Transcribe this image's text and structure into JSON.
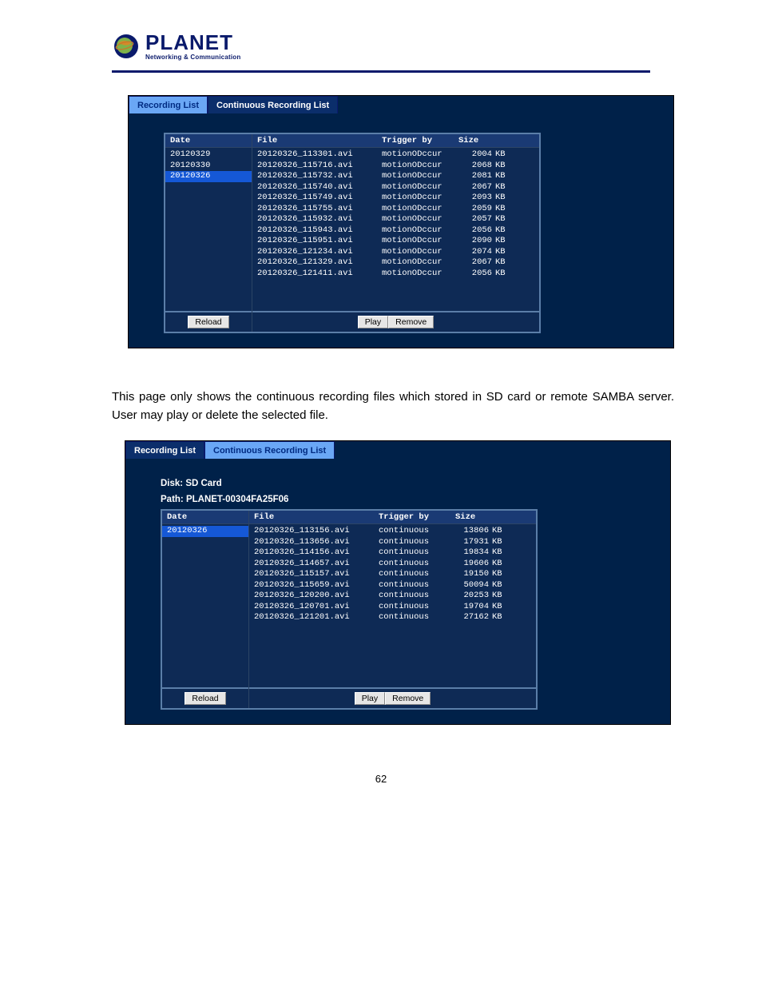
{
  "brand": {
    "name": "PLANET",
    "tagline": "Networking & Communication"
  },
  "tabs": {
    "recording": "Recording List",
    "continuous": "Continuous Recording List"
  },
  "columns": {
    "date": "Date",
    "file": "File",
    "trigger": "Trigger by",
    "size": "Size"
  },
  "buttons": {
    "reload": "Reload",
    "play": "Play",
    "remove": "Remove"
  },
  "panel1": {
    "dates": [
      "20120329",
      "20120330",
      "20120326"
    ],
    "selected_index": 2,
    "files": [
      {
        "file": "20120326_113301.avi",
        "trigger": "motionODccur",
        "size": "2004",
        "unit": "KB"
      },
      {
        "file": "20120326_115716.avi",
        "trigger": "motionODccur",
        "size": "2068",
        "unit": "KB"
      },
      {
        "file": "20120326_115732.avi",
        "trigger": "motionODccur",
        "size": "2081",
        "unit": "KB"
      },
      {
        "file": "20120326_115740.avi",
        "trigger": "motionODccur",
        "size": "2067",
        "unit": "KB"
      },
      {
        "file": "20120326_115749.avi",
        "trigger": "motionODccur",
        "size": "2093",
        "unit": "KB"
      },
      {
        "file": "20120326_115755.avi",
        "trigger": "motionODccur",
        "size": "2059",
        "unit": "KB"
      },
      {
        "file": "20120326_115932.avi",
        "trigger": "motionODccur",
        "size": "2057",
        "unit": "KB"
      },
      {
        "file": "20120326_115943.avi",
        "trigger": "motionODccur",
        "size": "2056",
        "unit": "KB"
      },
      {
        "file": "20120326_115951.avi",
        "trigger": "motionODccur",
        "size": "2090",
        "unit": "KB"
      },
      {
        "file": "20120326_121234.avi",
        "trigger": "motionODccur",
        "size": "2074",
        "unit": "KB"
      },
      {
        "file": "20120326_121329.avi",
        "trigger": "motionODccur",
        "size": "2067",
        "unit": "KB"
      },
      {
        "file": "20120326_121411.avi",
        "trigger": "motionODccur",
        "size": "2056",
        "unit": "KB"
      }
    ]
  },
  "paragraph_text": "This page only shows the continuous recording files which stored in SD card or remote SAMBA server. User may play or delete the selected file.",
  "panel2": {
    "disk_label": "Disk: SD Card",
    "path_label": "Path: PLANET-00304FA25F06",
    "dates": [
      "20120326"
    ],
    "selected_index": 0,
    "files": [
      {
        "file": "20120326_113156.avi",
        "trigger": "continuous",
        "size": "13806",
        "unit": "KB"
      },
      {
        "file": "20120326_113656.avi",
        "trigger": "continuous",
        "size": "17931",
        "unit": "KB"
      },
      {
        "file": "20120326_114156.avi",
        "trigger": "continuous",
        "size": "19834",
        "unit": "KB"
      },
      {
        "file": "20120326_114657.avi",
        "trigger": "continuous",
        "size": "19606",
        "unit": "KB"
      },
      {
        "file": "20120326_115157.avi",
        "trigger": "continuous",
        "size": "19150",
        "unit": "KB"
      },
      {
        "file": "20120326_115659.avi",
        "trigger": "continuous",
        "size": "50094",
        "unit": "KB"
      },
      {
        "file": "20120326_120200.avi",
        "trigger": "continuous",
        "size": "20253",
        "unit": "KB"
      },
      {
        "file": "20120326_120701.avi",
        "trigger": "continuous",
        "size": "19704",
        "unit": "KB"
      },
      {
        "file": "20120326_121201.avi",
        "trigger": "continuous",
        "size": "27162",
        "unit": "KB"
      }
    ]
  },
  "page_number": "62"
}
